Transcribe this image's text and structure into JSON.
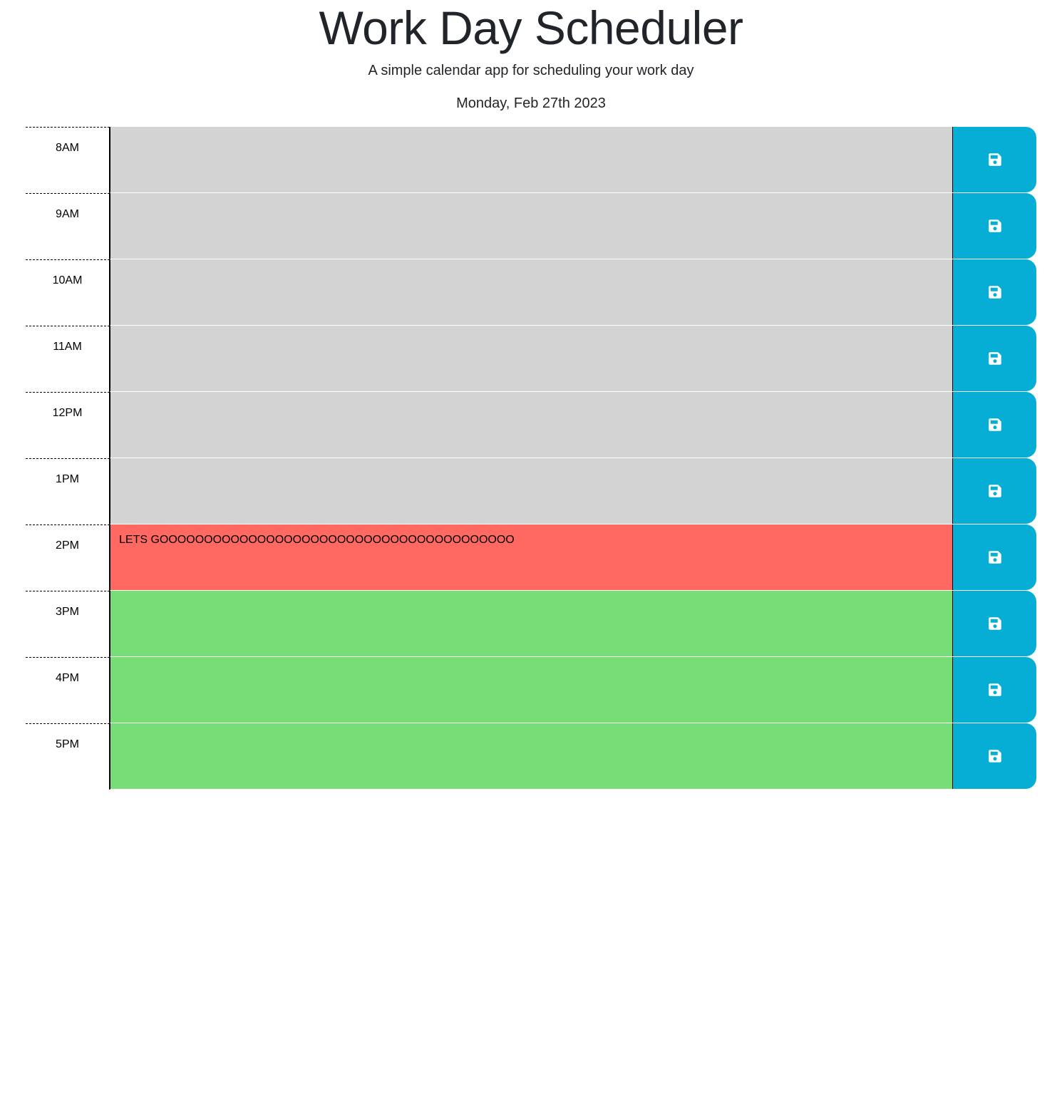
{
  "header": {
    "title": "Work Day Scheduler",
    "subtitle": "A simple calendar app for scheduling your work day",
    "current_day": "Monday, Feb 27th 2023"
  },
  "colors": {
    "past": "#d3d3d3",
    "present": "#ff6961",
    "future": "#77dd77",
    "save_button": "#06aed5",
    "save_icon": "#ffffff"
  },
  "time_blocks": [
    {
      "hour": "8AM",
      "status": "past",
      "text": "",
      "icon": "save-icon"
    },
    {
      "hour": "9AM",
      "status": "past",
      "text": "",
      "icon": "save-icon"
    },
    {
      "hour": "10AM",
      "status": "past",
      "text": "",
      "icon": "save-icon"
    },
    {
      "hour": "11AM",
      "status": "past",
      "text": "",
      "icon": "save-icon"
    },
    {
      "hour": "12PM",
      "status": "past",
      "text": "",
      "icon": "save-icon"
    },
    {
      "hour": "1PM",
      "status": "past",
      "text": "",
      "icon": "save-icon"
    },
    {
      "hour": "2PM",
      "status": "present",
      "text": "LETS GOOOOOOOOOOOOOOOOOOOOOOOOOOOOOOOOOOOOOOOO",
      "icon": "save-icon"
    },
    {
      "hour": "3PM",
      "status": "future",
      "text": "",
      "icon": "save-icon"
    },
    {
      "hour": "4PM",
      "status": "future",
      "text": "",
      "icon": "save-icon"
    },
    {
      "hour": "5PM",
      "status": "future",
      "text": "",
      "icon": "save-icon"
    }
  ]
}
